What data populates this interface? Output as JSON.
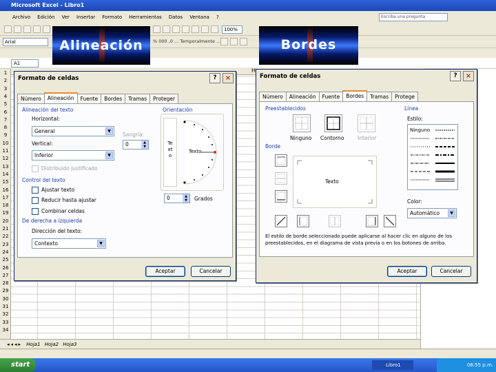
{
  "excel": {
    "title": "Microsoft Excel - Libro1",
    "menu": [
      "Archivo",
      "Edición",
      "Ver",
      "Insertar",
      "Formato",
      "Herramientas",
      "Datos",
      "Ventana",
      "?"
    ],
    "ask_placeholder": "Escriba una pregunta",
    "font_name": "Arial",
    "zoom": "100%",
    "namebox": "A1",
    "column_h": "H",
    "rows": [
      "1",
      "2",
      "3",
      "4",
      "5",
      "6",
      "7",
      "8",
      "9",
      "10",
      "11",
      "12",
      "13",
      "14",
      "15",
      "16",
      "17",
      "18",
      "19",
      "20",
      "21",
      "22",
      "23",
      "24",
      "25",
      "26",
      "27",
      "28",
      "29",
      "30",
      "31",
      "32",
      "33",
      "34"
    ],
    "sheets": [
      "Hoja1",
      "Hoja2",
      "Hoja3"
    ],
    "toolbar_partial_text": "% 000 ,0 ...  Temporalmente ..."
  },
  "taskbar": {
    "start_label": "start",
    "task_label": "Libro1",
    "tray_time": "08:55 p.m."
  },
  "banners": {
    "left": "Alineación",
    "right": "Bordes"
  },
  "dialog_left": {
    "title": "Formato de celdas",
    "help": "?",
    "close": "×",
    "tabs": [
      "Número",
      "Alineación",
      "Fuente",
      "Bordes",
      "Tramas",
      "Proteger"
    ],
    "active_tab": "Alineación",
    "text_alignment_section": "Alineación del texto",
    "horizontal_label": "Horizontal:",
    "horizontal_value": "General",
    "vertical_label": "Vertical:",
    "vertical_value": "Inferior",
    "indent_label": "Sangría:",
    "indent_value": "0",
    "distributed_justify": "Distribuido justificado",
    "text_control_section": "Control del texto",
    "wrap_text": "Ajustar texto",
    "shrink_to_fit": "Reducir hasta ajustar",
    "merge_cells": "Combinar celdas",
    "rtl_section": "De derecha a izquierda",
    "text_direction_label": "Dirección del texto:",
    "text_direction_value": "Contexto",
    "orientation_section": "Orientación",
    "vertical_text": "Texto",
    "orientation_text": "Texto",
    "degrees_value": "0",
    "degrees_label": "Grados",
    "ok": "Aceptar",
    "cancel": "Cancelar"
  },
  "dialog_right": {
    "title": "Formato de celdas",
    "help": "?",
    "close": "×",
    "tabs": [
      "Número",
      "Alineación",
      "Fuente",
      "Bordes",
      "Tramas",
      "Protege"
    ],
    "active_tab": "Bordes",
    "presets_section": "Preestablecidos",
    "preset_none": "Ninguno",
    "preset_outline": "Contorno",
    "preset_inside": "Interior",
    "border_section": "Borde",
    "preview_text": "Texto",
    "line_section": "Línea",
    "style_label": "Estilo:",
    "style_none": "Ninguno",
    "color_label": "Color:",
    "color_value": "Automático",
    "description": "El estilo de borde seleccionado puede aplicarse al hacer clic en alguno de los preestablecidos, en el diagrama de vista previa o en los botones de arriba.",
    "ok": "Aceptar",
    "cancel": "Cancelar"
  },
  "colors": {
    "tab_active_accent": "#e68b2c",
    "section_heading": "#1b3ea8",
    "banner_blue": "#3a78ff"
  }
}
